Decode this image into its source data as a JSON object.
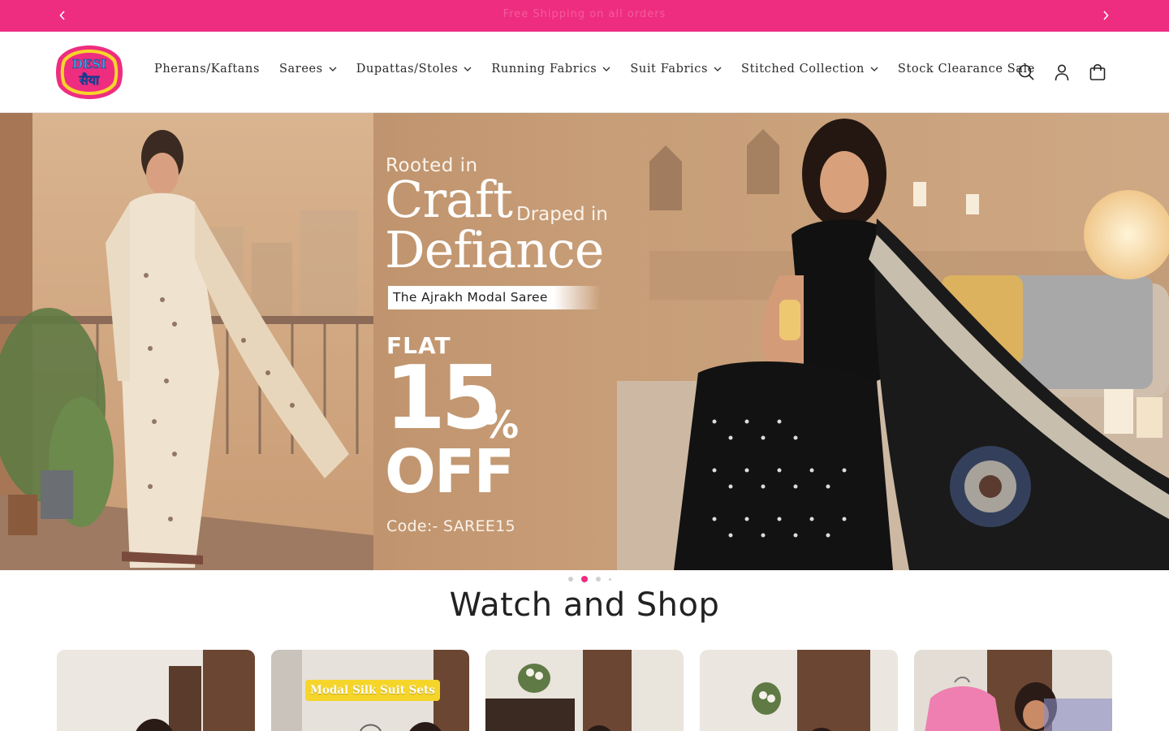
{
  "announcement": {
    "message": "Free Shipping on all orders",
    "prev_icon": "chevron-left-icon",
    "next_icon": "chevron-right-icon"
  },
  "header": {
    "logo_text_top": "DESI",
    "logo_text_bottom": "सैया",
    "nav": [
      {
        "label": "Pherans/Kaftans",
        "dropdown": false
      },
      {
        "label": "Sarees",
        "dropdown": true
      },
      {
        "label": "Dupattas/Stoles",
        "dropdown": true
      },
      {
        "label": "Running Fabrics",
        "dropdown": true
      },
      {
        "label": "Suit Fabrics",
        "dropdown": true
      },
      {
        "label": "Stitched Collection",
        "dropdown": true
      },
      {
        "label": "Stock Clearance Sale",
        "dropdown": false
      }
    ],
    "icons": [
      "search-icon",
      "account-icon",
      "cart-icon"
    ]
  },
  "hero": {
    "line1": "Rooted in",
    "line2": "Craft",
    "line3": "Draped in",
    "line4": "Defiance",
    "tagline": "The Ajrakh Modal Saree",
    "flat": "FLAT",
    "discount": "15",
    "percent": "%",
    "off": "OFF",
    "code": "Code:- SAREE15",
    "slide_count": 4,
    "active_slide": 2
  },
  "section": {
    "title": "Watch and Shop",
    "cards": [
      {
        "badge": ""
      },
      {
        "badge": "Modal Silk Suit Sets"
      },
      {
        "badge": ""
      },
      {
        "badge": ""
      },
      {
        "badge": ""
      }
    ]
  },
  "colors": {
    "brand_pink": "#ee2d80",
    "dot_inactive": "#cfcfcf"
  }
}
